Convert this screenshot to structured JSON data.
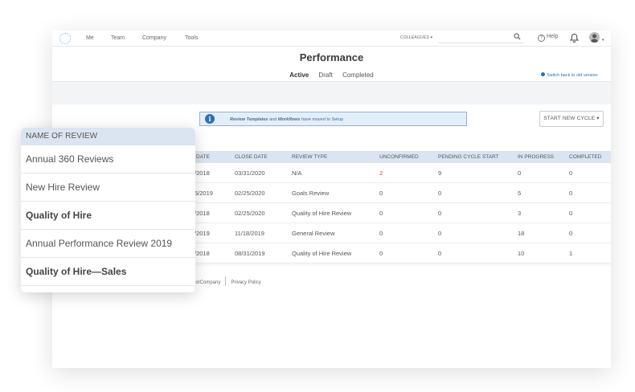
{
  "nav": {
    "items": [
      "Me",
      "Team",
      "Company",
      "Tools"
    ],
    "colleagues_label": "COLLEAGUES ▾",
    "help_label": "Help"
  },
  "page": {
    "title": "Performance",
    "tabs": [
      "Active",
      "Draft",
      "Completed"
    ],
    "active_tab": "Active",
    "switch_link": "Switch back to old version"
  },
  "banner": {
    "part1": "Review Templates",
    "part2": " and ",
    "part3": "Workflows",
    "part4": " have moved to ",
    "part5": "Setup"
  },
  "start_cycle_label": "START NEW CYCLE ▾",
  "table": {
    "columns": [
      "DATE",
      "CLOSE DATE",
      "REVIEW TYPE",
      "UNCONFIRMED",
      "PENDING CYCLE START",
      "IN PROGRESS",
      "COMPLETED"
    ],
    "rows": [
      {
        "date": "/2018",
        "close": "03/31/2020",
        "type": "N/A",
        "unconfirmed": "2",
        "pending": "9",
        "progress": "0",
        "completed": "0"
      },
      {
        "date": "5/2019",
        "close": "02/25/2020",
        "type": "Goals Review",
        "unconfirmed": "0",
        "pending": "0",
        "progress": "5",
        "completed": "0"
      },
      {
        "date": "/2018",
        "close": "02/25/2020",
        "type": "Quality of Hire Review",
        "unconfirmed": "0",
        "pending": "0",
        "progress": "3",
        "completed": "0"
      },
      {
        "date": "/2019",
        "close": "11/18/2019",
        "type": "General Review",
        "unconfirmed": "0",
        "pending": "0",
        "progress": "18",
        "completed": "0"
      },
      {
        "date": "/2018",
        "close": "08/31/2019",
        "type": "Quality of Hire Review",
        "unconfirmed": "0",
        "pending": "0",
        "progress": "10",
        "completed": "1"
      }
    ]
  },
  "footer": {
    "company": "eorCompany",
    "privacy": "Privacy Policy"
  },
  "card": {
    "header": "NAME OF REVIEW",
    "items": [
      "Annual 360 Reviews",
      "New Hire Review",
      "Quality of Hire",
      "Annual Performance Review 2019",
      "Quality of Hire—Sales"
    ]
  },
  "colors": {
    "accent_blue": "#2e6fb3",
    "header_blue": "#dbe5f1",
    "alert_red": "#e03a3a"
  }
}
